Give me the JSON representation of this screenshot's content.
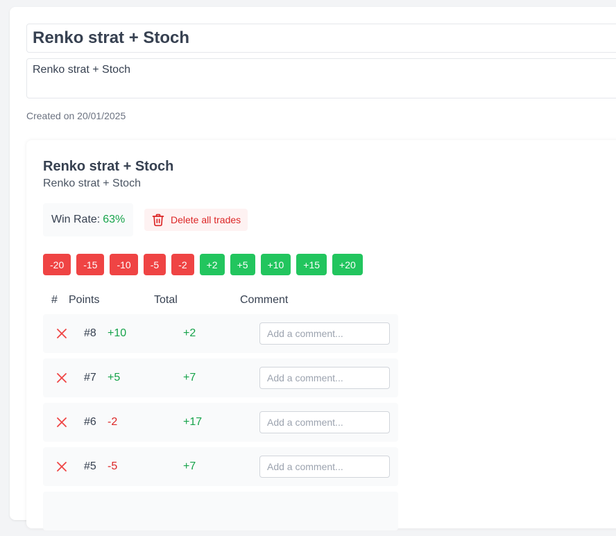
{
  "strategy": {
    "title": "Renko strat + Stoch",
    "description": "Renko strat + Stoch",
    "created": "Created on 20/01/2025"
  },
  "card": {
    "title": "Renko strat + Stoch",
    "description": "Renko strat + Stoch"
  },
  "stats": {
    "win_rate_label": "Win Rate:",
    "win_rate_value": "63%"
  },
  "actions": {
    "delete_all": "Delete all trades"
  },
  "quick_buttons": [
    {
      "label": "-20",
      "kind": "neg"
    },
    {
      "label": "-15",
      "kind": "neg"
    },
    {
      "label": "-10",
      "kind": "neg"
    },
    {
      "label": "-5",
      "kind": "neg"
    },
    {
      "label": "-2",
      "kind": "neg"
    },
    {
      "label": "+2",
      "kind": "pos"
    },
    {
      "label": "+5",
      "kind": "pos"
    },
    {
      "label": "+10",
      "kind": "pos"
    },
    {
      "label": "+15",
      "kind": "pos"
    },
    {
      "label": "+20",
      "kind": "pos"
    }
  ],
  "table": {
    "headers": {
      "num": "#",
      "points": "Points",
      "total": "Total",
      "comment": "Comment"
    },
    "comment_placeholder": "Add a comment...",
    "rows": [
      {
        "num": "#8",
        "points": "+10",
        "points_sign": "pos",
        "total": "+2",
        "total_sign": "pos"
      },
      {
        "num": "#7",
        "points": "+5",
        "points_sign": "pos",
        "total": "+7",
        "total_sign": "pos"
      },
      {
        "num": "#6",
        "points": "-2",
        "points_sign": "neg",
        "total": "+17",
        "total_sign": "pos"
      },
      {
        "num": "#5",
        "points": "-5",
        "points_sign": "neg",
        "total": "+7",
        "total_sign": "pos"
      }
    ]
  },
  "colors": {
    "positive": "#16a34a",
    "negative": "#dc2626",
    "positive_button": "#22c55e",
    "negative_button": "#ef4444"
  },
  "icons": {
    "delete": "trash-icon",
    "remove_row": "close-icon"
  }
}
